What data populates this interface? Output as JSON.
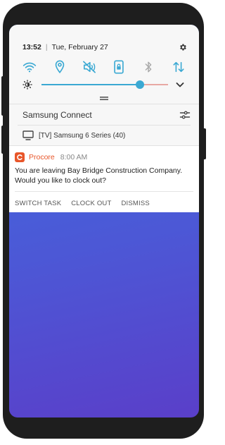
{
  "status_bar": {
    "time": "13:52",
    "separator": "|",
    "date": "Tue, February 27"
  },
  "quick_toggles": [
    {
      "icon": "wifi-icon",
      "state": "on"
    },
    {
      "icon": "location-icon",
      "state": "on"
    },
    {
      "icon": "sound-mute-icon",
      "state": "on"
    },
    {
      "icon": "rotation-lock-icon",
      "state": "on"
    },
    {
      "icon": "bluetooth-icon",
      "state": "off"
    },
    {
      "icon": "mobile-data-icon",
      "state": "on"
    }
  ],
  "brightness": {
    "level": 0.78
  },
  "samsung_connect": {
    "title": "Samsung Connect",
    "device": "[TV] Samsung 6 Series (40)"
  },
  "notification": {
    "app_name": "Procore",
    "time": "8:00 AM",
    "message": "You are leaving Bay Bridge Construction Company. Would you like to clock out?",
    "actions": [
      "SWITCH TASK",
      "CLOCK OUT",
      "DISMISS"
    ]
  },
  "colors": {
    "toggle_on": "#3ba9d3",
    "toggle_off": "#a9a9a9",
    "procore_orange": "#e8562a",
    "wallpaper_top": "#3c6fe1",
    "wallpaper_bottom": "#5a3fc9"
  }
}
